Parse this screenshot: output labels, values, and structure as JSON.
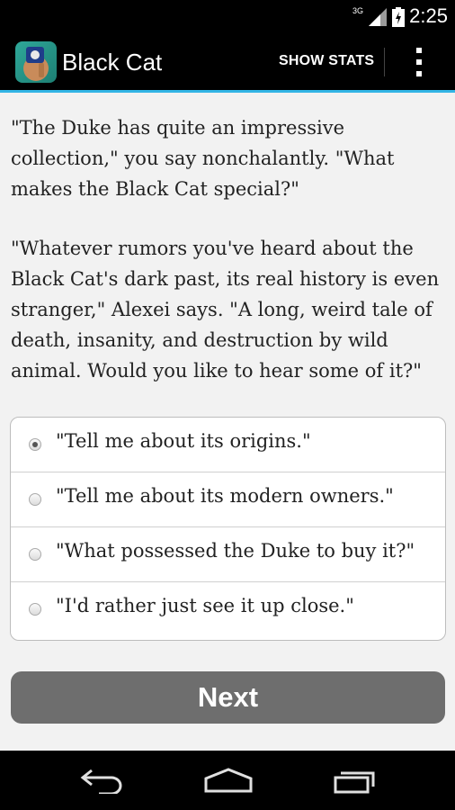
{
  "status_bar": {
    "time": "2:25",
    "network_label": "3G",
    "icons": [
      "signal-icon",
      "battery-icon"
    ]
  },
  "action_bar": {
    "title": "Black Cat",
    "show_stats_label": "SHOW STATS",
    "icons": [
      "app-icon",
      "overflow-menu-icon"
    ],
    "accent_color": "#33b5e5"
  },
  "story": {
    "paragraph1": "\"The Duke has quite an impressive collection,\" you say nonchalantly. \"What makes the Black Cat special?\"",
    "paragraph2": "\"Whatever rumors you've heard about the Black Cat's dark past, its real history is even stranger,\" Alexei says. \"A long, weird tale of death, insanity, and destruction by wild animal. Would you like to hear some of it?\""
  },
  "choices": [
    {
      "label": "\"Tell me about its origins.\"",
      "selected": true
    },
    {
      "label": "\"Tell me about its modern owners.\"",
      "selected": false
    },
    {
      "label": "\"What possessed the Duke to buy it?\"",
      "selected": false
    },
    {
      "label": "\"I'd rather just see it up close.\"",
      "selected": false
    }
  ],
  "next_button": {
    "label": "Next",
    "color": "#6e6e6e"
  },
  "nav_bar": {
    "icons": [
      "back-icon",
      "home-icon",
      "recent-apps-icon"
    ]
  }
}
